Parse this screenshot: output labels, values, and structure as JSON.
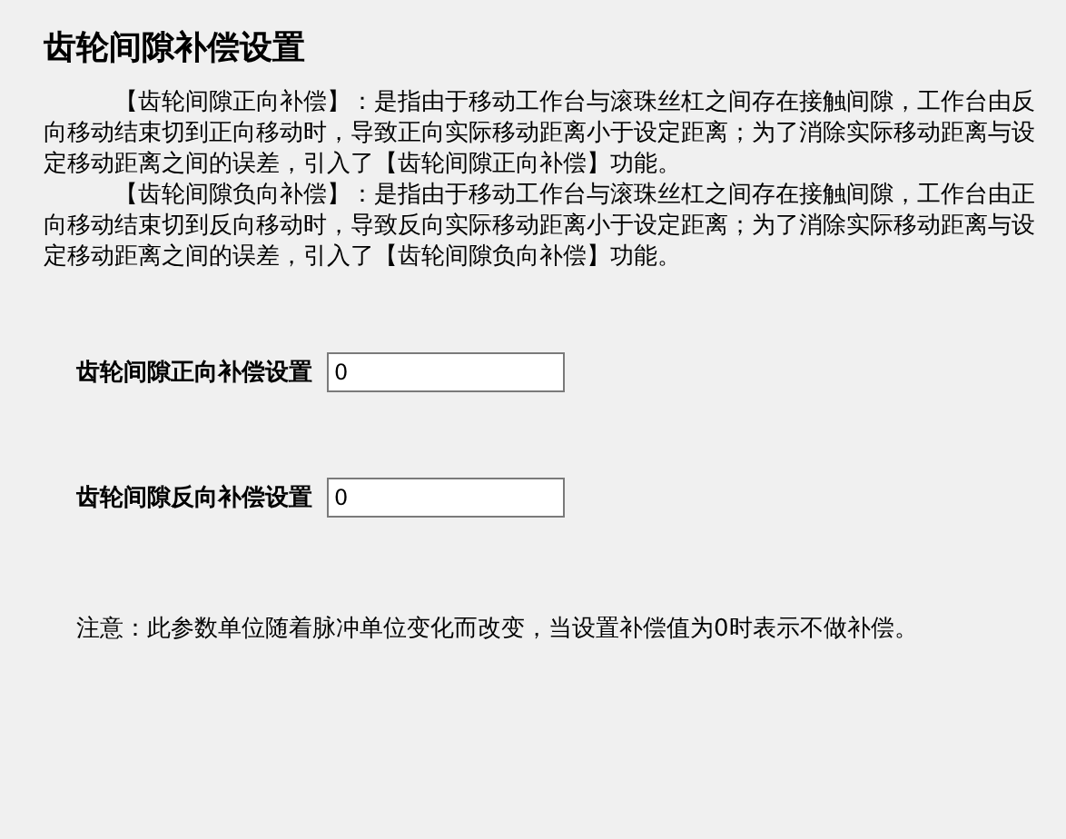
{
  "title": "齿轮间隙补偿设置",
  "paragraphs": [
    "【齿轮间隙正向补偿】：是指由于移动工作台与滚珠丝杠之间存在接触间隙，工作台由反向移动结束切到正向移动时，导致正向实际移动距离小于设定距离；为了消除实际移动距离与设定移动距离之间的误差，引入了【齿轮间隙正向补偿】功能。",
    "【齿轮间隙负向补偿】：是指由于移动工作台与滚珠丝杠之间存在接触间隙，工作台由正向移动结束切到反向移动时，导致反向实际移动距离小于设定距离；为了消除实际移动距离与设定移动距离之间的误差，引入了【齿轮间隙负向补偿】功能。"
  ],
  "fields": [
    {
      "label": "齿轮间隙正向补偿设置",
      "value": "0"
    },
    {
      "label": "齿轮间隙反向补偿设置",
      "value": "0"
    }
  ],
  "note": "注意：此参数单位随着脉冲单位变化而改变，当设置补偿值为0时表示不做补偿。"
}
